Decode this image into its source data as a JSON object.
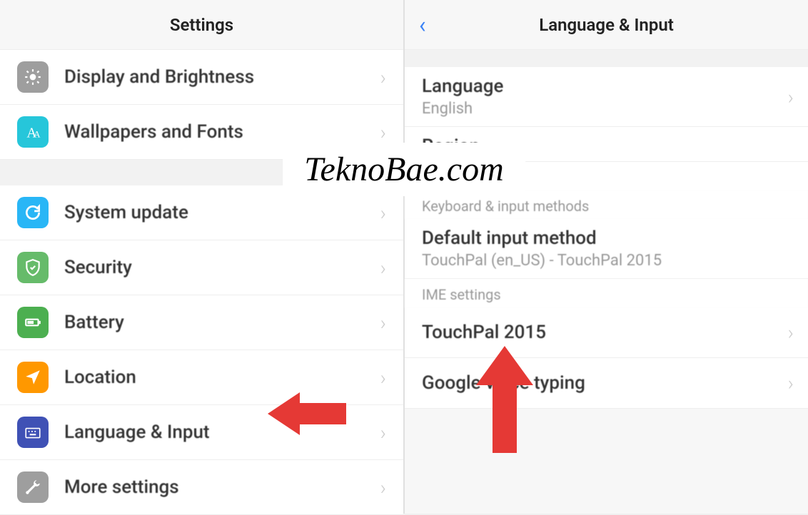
{
  "left": {
    "title": "Settings",
    "items": [
      {
        "label": "Display and Brightness",
        "icon": "brightness",
        "color": "bg-gray"
      },
      {
        "label": "Wallpapers and Fonts",
        "icon": "font",
        "color": "bg-teal"
      },
      {
        "spacer": true
      },
      {
        "label": "System update",
        "icon": "update",
        "color": "bg-blue"
      },
      {
        "label": "Security",
        "icon": "shield",
        "color": "bg-green"
      },
      {
        "label": "Battery",
        "icon": "battery",
        "color": "bg-green2"
      },
      {
        "label": "Location",
        "icon": "location",
        "color": "bg-orange"
      },
      {
        "label": "Language & Input",
        "icon": "keyboard",
        "color": "bg-indigo"
      },
      {
        "label": "More settings",
        "icon": "wrench",
        "color": "bg-gray2"
      }
    ]
  },
  "right": {
    "title": "Language & Input",
    "language": {
      "title": "Language",
      "value": "English"
    },
    "region": {
      "title": "Region"
    },
    "section1": "Keyboard & input methods",
    "default_input": {
      "title": "Default input method",
      "value": "TouchPal (en_US) - TouchPal 2015"
    },
    "section2": "IME settings",
    "ime1": {
      "title": "TouchPal 2015"
    },
    "ime2": {
      "title": "Google voice typing"
    }
  },
  "watermark": "TeknoBae.com"
}
